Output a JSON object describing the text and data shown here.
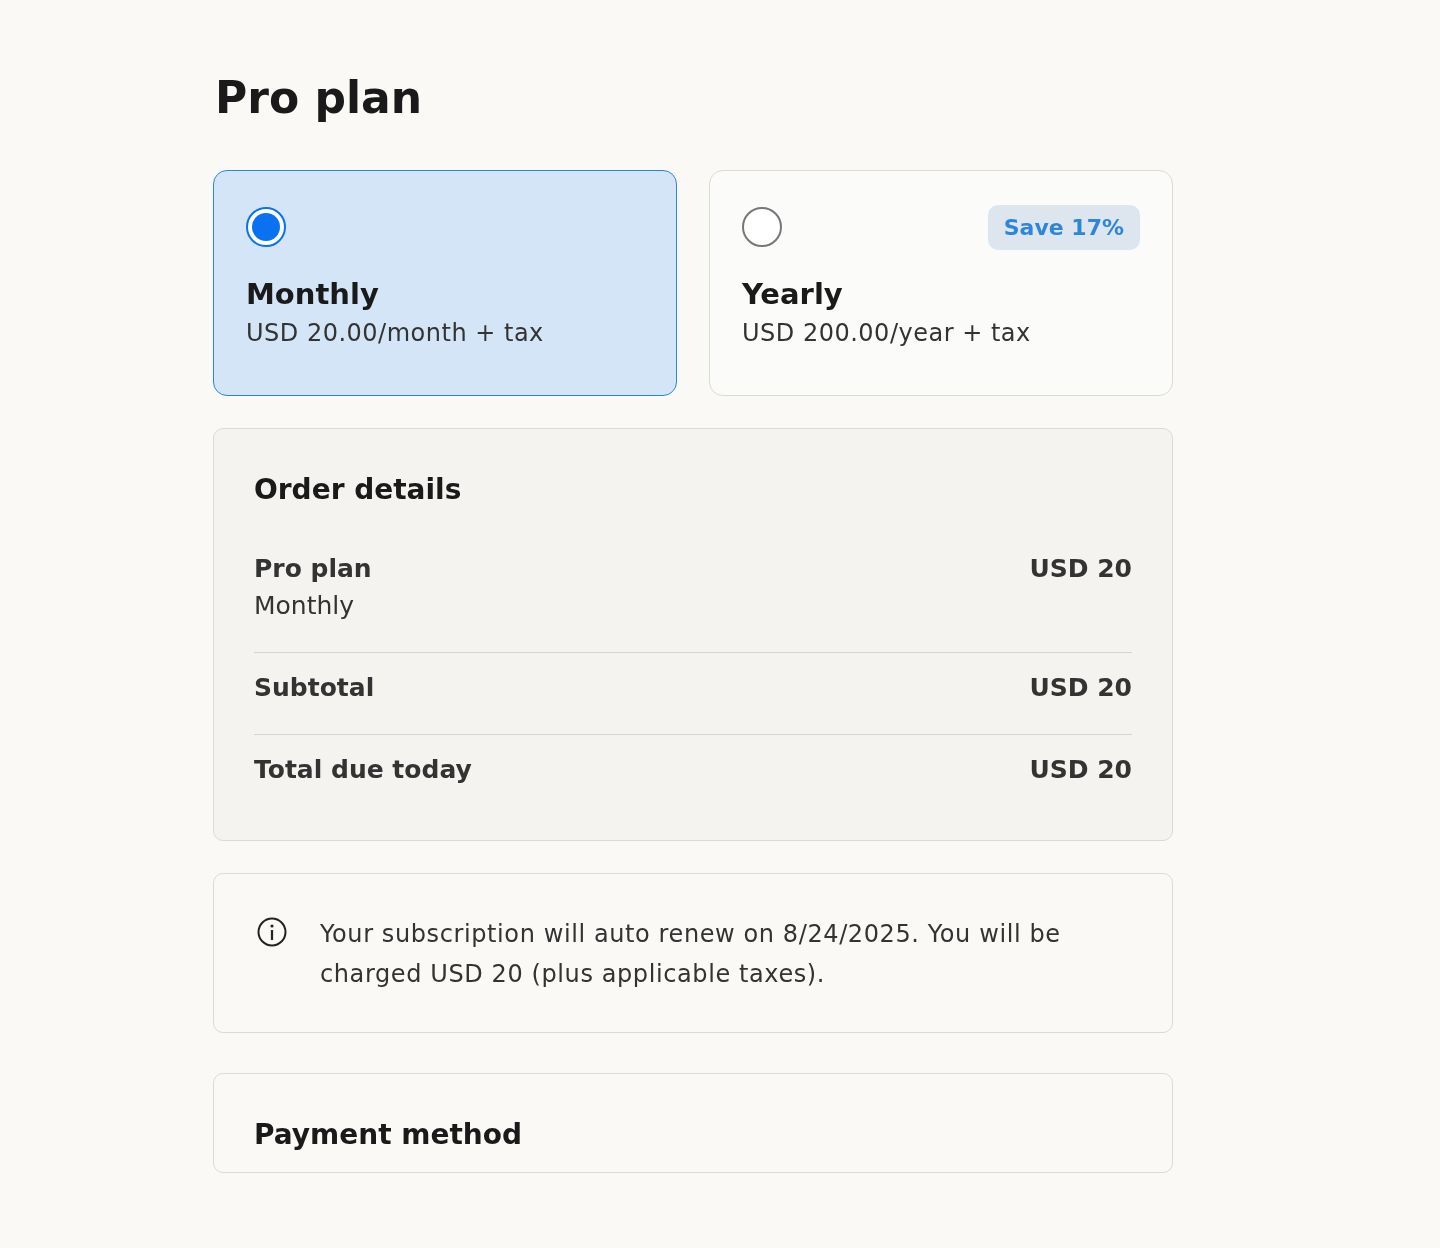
{
  "title": "Pro plan",
  "plans": [
    {
      "name": "Monthly",
      "price": "USD 20.00/month + tax",
      "selected": true
    },
    {
      "name": "Yearly",
      "price": "USD 200.00/year + tax",
      "selected": false,
      "badge": "Save 17%"
    }
  ],
  "order_details": {
    "title": "Order details",
    "rows": [
      {
        "label": "Pro plan",
        "sublabel": "Monthly",
        "amount": "USD 20"
      },
      {
        "label": "Subtotal",
        "amount": "USD 20"
      },
      {
        "label": "Total due today",
        "amount": "USD 20"
      }
    ]
  },
  "notice": {
    "text": "Your subscription will auto renew on 8/24/2025. You will be charged USD 20 (plus applicable taxes)."
  },
  "payment_method": {
    "title": "Payment method"
  }
}
